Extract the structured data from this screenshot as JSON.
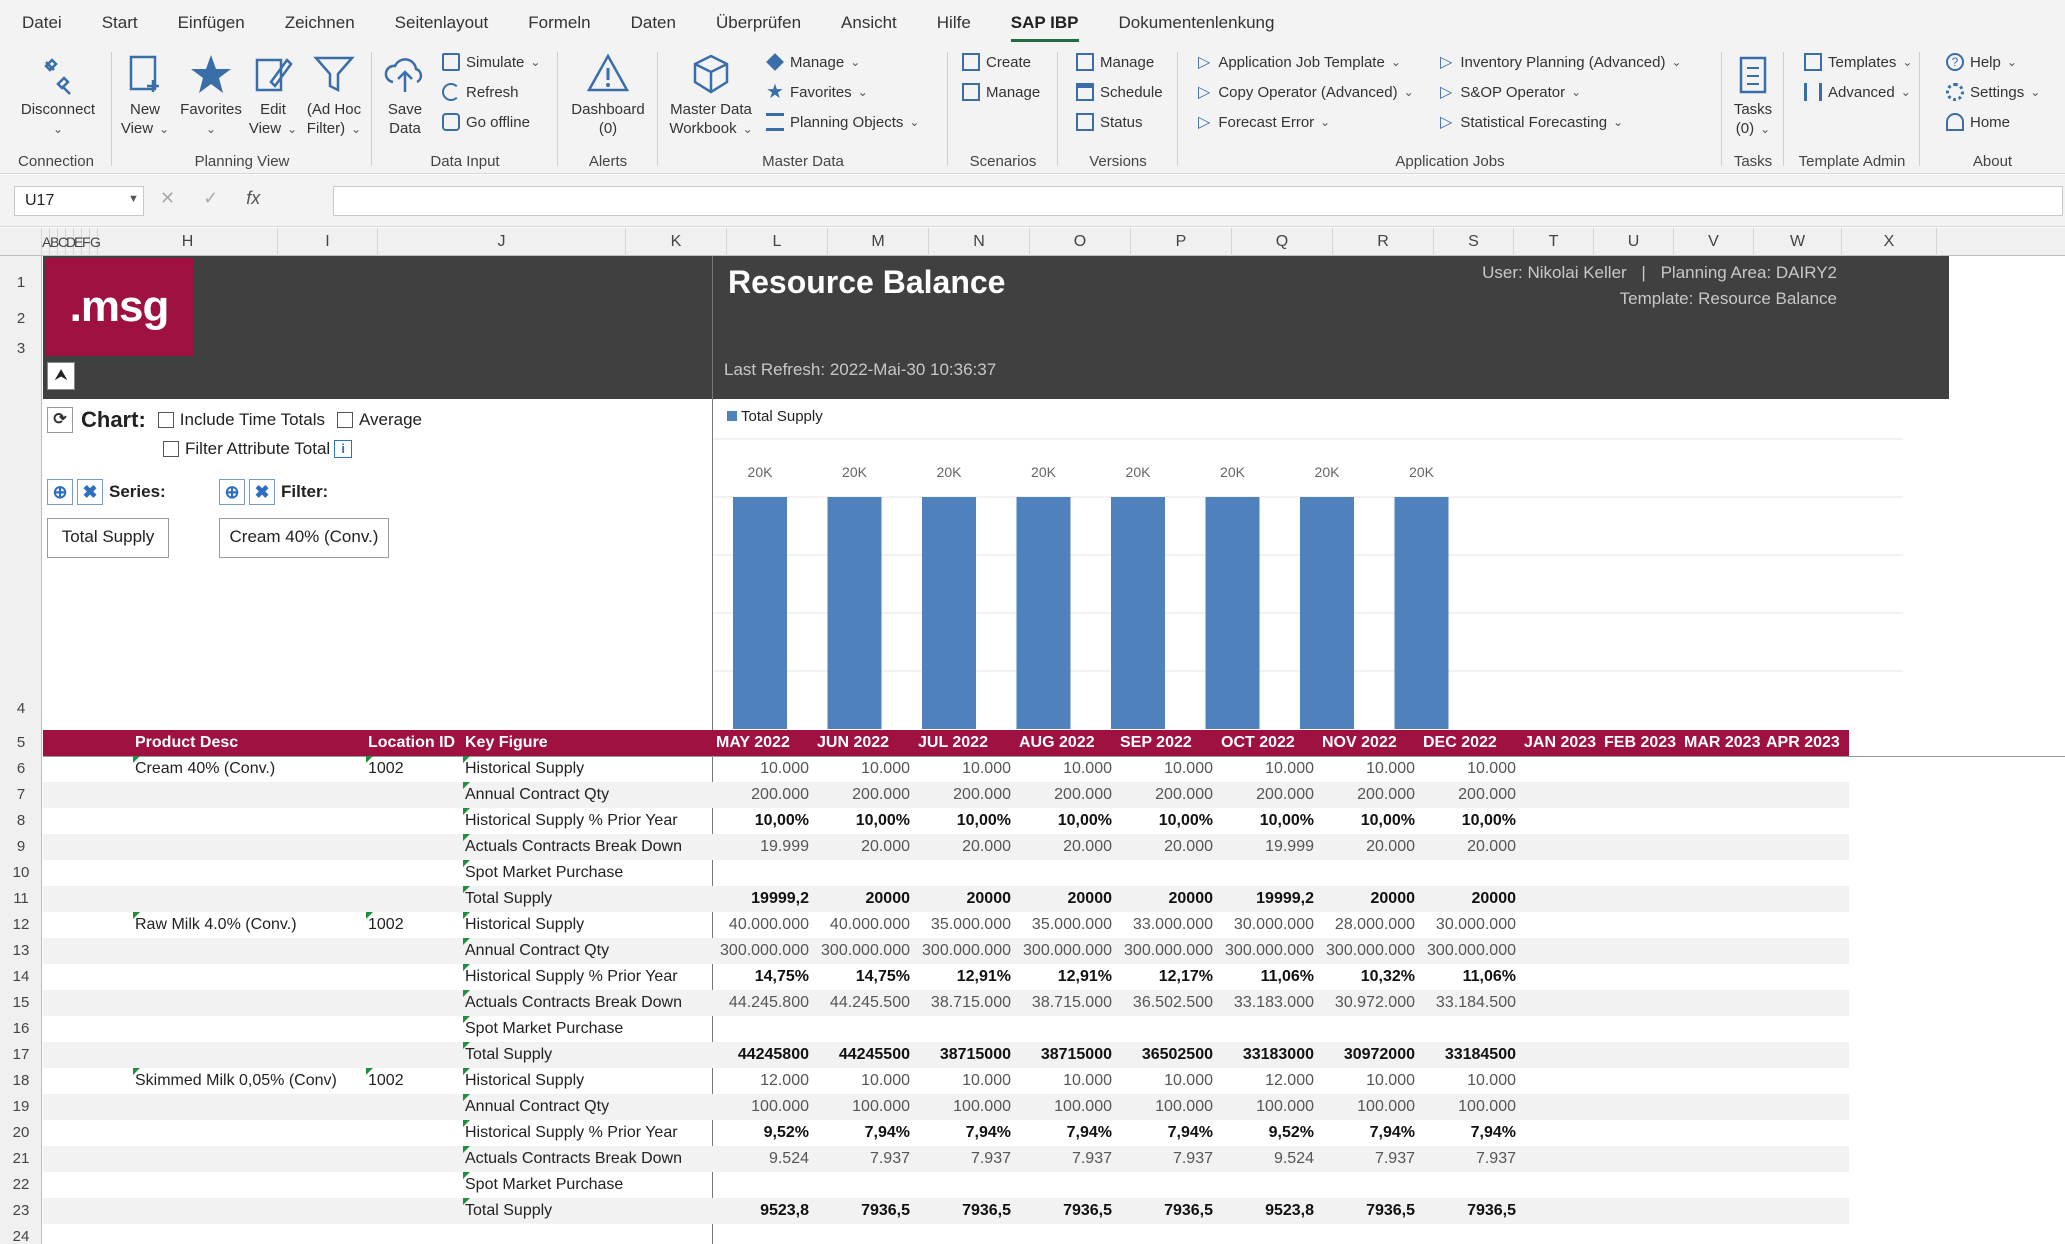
{
  "menu": [
    "Datei",
    "Start",
    "Einfügen",
    "Zeichnen",
    "Seitenlayout",
    "Formeln",
    "Daten",
    "Überprüfen",
    "Ansicht",
    "Hilfe",
    "SAP IBP",
    "Dokumentenlenkung"
  ],
  "ribbon": {
    "connection": {
      "disconnect": "Disconnect",
      "group": "Connection"
    },
    "planning_view": {
      "new_view": "New",
      "new_view2": "View",
      "favorites": "Favorites",
      "edit_view": "Edit",
      "edit_view2": "View",
      "adhoc": "(Ad Hoc",
      "adhoc2": "Filter)",
      "group": "Planning View"
    },
    "data_input": {
      "save": "Save",
      "save2": "Data",
      "simulate": "Simulate",
      "refresh": "Refresh",
      "go_offline": "Go offline",
      "group": "Data Input"
    },
    "alerts": {
      "dashboard": "Dashboard",
      "count": "(0)",
      "group": "Alerts"
    },
    "master_data": {
      "workbook": "Master Data",
      "workbook2": "Workbook",
      "manage": "Manage",
      "favorites": "Favorites",
      "planning_objects": "Planning Objects",
      "group": "Master Data"
    },
    "scenarios": {
      "create": "Create",
      "manage": "Manage",
      "group": "Scenarios"
    },
    "versions": {
      "manage": "Manage",
      "schedule": "Schedule",
      "status": "Status",
      "group": "Versions"
    },
    "app_jobs": {
      "template": "Application Job Template",
      "copy_op": "Copy Operator (Advanced)",
      "forecast_error": "Forecast Error",
      "inv_planning": "Inventory Planning (Advanced)",
      "sop": "S&OP Operator",
      "stat_forecast": "Statistical Forecasting",
      "group": "Application Jobs"
    },
    "tasks": {
      "tasks": "Tasks",
      "count": "(0)",
      "group": "Tasks"
    },
    "template_admin": {
      "templates": "Templates",
      "advanced": "Advanced",
      "group": "Template Admin"
    },
    "about": {
      "help": "Help",
      "settings": "Settings",
      "home": "Home",
      "group": "About"
    }
  },
  "formula": {
    "namebox": "U17",
    "fx": "fx",
    "value": ""
  },
  "columns": [
    "A",
    "B",
    "C",
    "D",
    "E",
    "F",
    "G",
    "H",
    "I",
    "J",
    "K",
    "L",
    "M",
    "N",
    "O",
    "P",
    "Q",
    "R",
    "S",
    "T",
    "U",
    "V",
    "W",
    "X"
  ],
  "rows": [
    "1",
    "2",
    "3",
    "4",
    "5",
    "6",
    "7",
    "8",
    "9",
    "10",
    "11",
    "12",
    "13",
    "14",
    "15",
    "16",
    "17",
    "18",
    "19",
    "20",
    "21",
    "22",
    "23",
    "24"
  ],
  "banner": {
    "logo": ".msg",
    "title": "Resource Balance",
    "user": "User: Nikolai Keller",
    "area": "Planning Area: DAIRY2",
    "template": "Template: Resource Balance",
    "last_refresh": "Last Refresh: 2022-Mai-30  10:36:37"
  },
  "chart_controls": {
    "chart_label": "Chart:",
    "include_time_totals": "Include Time Totals",
    "average": "Average",
    "filter_attr_total": "Filter Attribute Total",
    "series_label": "Series:",
    "filter_label": "Filter:",
    "series_value": "Total Supply",
    "filter_value": "Cream 40% (Conv.)"
  },
  "chart_data": {
    "type": "bar",
    "categories": [
      "MAY 2022",
      "JUN 2022",
      "JUL 2022",
      "AUG 2022",
      "SEP 2022",
      "OCT 2022",
      "NOV 2022",
      "DEC 2022"
    ],
    "series": [
      {
        "name": "Total Supply",
        "values": [
          19999.2,
          20000,
          20000,
          20000,
          20000,
          19999.2,
          20000,
          20000
        ],
        "labels": [
          "20K",
          "20K",
          "20K",
          "20K",
          "20K",
          "20K",
          "20K",
          "20K"
        ],
        "color": "#4f81bd"
      }
    ],
    "ylim": [
      0,
      25000
    ],
    "legend": "top-left",
    "grid": true
  },
  "table": {
    "headers": {
      "product": "Product Desc",
      "location": "Location ID",
      "keyfigure": "Key Figure"
    },
    "months": [
      "MAY 2022",
      "JUN 2022",
      "JUL 2022",
      "AUG 2022",
      "SEP 2022",
      "OCT 2022",
      "NOV 2022",
      "DEC 2022",
      "JAN 2023",
      "FEB 2023",
      "MAR 2023",
      "APR 2023"
    ],
    "rows": [
      {
        "product": "Cream 40% (Conv.)",
        "location": "1002",
        "kf": "Historical Supply",
        "bold": false,
        "vals": [
          "10.000",
          "10.000",
          "10.000",
          "10.000",
          "10.000",
          "10.000",
          "10.000",
          "10.000"
        ]
      },
      {
        "product": "",
        "location": "",
        "kf": "Annual Contract Qty",
        "bold": false,
        "vals": [
          "200.000",
          "200.000",
          "200.000",
          "200.000",
          "200.000",
          "200.000",
          "200.000",
          "200.000"
        ]
      },
      {
        "product": "",
        "location": "",
        "kf": "Historical Supply % Prior Year",
        "bold": true,
        "vals": [
          "10,00%",
          "10,00%",
          "10,00%",
          "10,00%",
          "10,00%",
          "10,00%",
          "10,00%",
          "10,00%"
        ]
      },
      {
        "product": "",
        "location": "",
        "kf": "Actuals Contracts Break Down",
        "bold": false,
        "vals": [
          "19.999",
          "20.000",
          "20.000",
          "20.000",
          "20.000",
          "19.999",
          "20.000",
          "20.000"
        ]
      },
      {
        "product": "",
        "location": "",
        "kf": "Spot Market Purchase",
        "bold": false,
        "vals": [
          "",
          "",
          "",
          "",
          "",
          "",
          "",
          ""
        ]
      },
      {
        "product": "",
        "location": "",
        "kf": "Total Supply",
        "bold": true,
        "vals": [
          "19999,2",
          "20000",
          "20000",
          "20000",
          "20000",
          "19999,2",
          "20000",
          "20000"
        ]
      },
      {
        "product": "Raw Milk 4.0% (Conv.)",
        "location": "1002",
        "kf": "Historical Supply",
        "bold": false,
        "vals": [
          "40.000.000",
          "40.000.000",
          "35.000.000",
          "35.000.000",
          "33.000.000",
          "30.000.000",
          "28.000.000",
          "30.000.000"
        ]
      },
      {
        "product": "",
        "location": "",
        "kf": "Annual Contract Qty",
        "bold": false,
        "vals": [
          "300.000.000",
          "300.000.000",
          "300.000.000",
          "300.000.000",
          "300.000.000",
          "300.000.000",
          "300.000.000",
          "300.000.000"
        ]
      },
      {
        "product": "",
        "location": "",
        "kf": "Historical Supply % Prior Year",
        "bold": true,
        "vals": [
          "14,75%",
          "14,75%",
          "12,91%",
          "12,91%",
          "12,17%",
          "11,06%",
          "10,32%",
          "11,06%"
        ]
      },
      {
        "product": "",
        "location": "",
        "kf": "Actuals Contracts Break Down",
        "bold": false,
        "vals": [
          "44.245.800",
          "44.245.500",
          "38.715.000",
          "38.715.000",
          "36.502.500",
          "33.183.000",
          "30.972.000",
          "33.184.500"
        ]
      },
      {
        "product": "",
        "location": "",
        "kf": "Spot Market Purchase",
        "bold": false,
        "vals": [
          "",
          "",
          "",
          "",
          "",
          "",
          "",
          ""
        ]
      },
      {
        "product": "",
        "location": "",
        "kf": "Total Supply",
        "bold": true,
        "vals": [
          "44245800",
          "44245500",
          "38715000",
          "38715000",
          "36502500",
          "33183000",
          "30972000",
          "33184500"
        ]
      },
      {
        "product": "Skimmed Milk 0,05% (Conv)",
        "location": "1002",
        "kf": "Historical Supply",
        "bold": false,
        "vals": [
          "12.000",
          "10.000",
          "10.000",
          "10.000",
          "10.000",
          "12.000",
          "10.000",
          "10.000"
        ]
      },
      {
        "product": "",
        "location": "",
        "kf": "Annual Contract Qty",
        "bold": false,
        "vals": [
          "100.000",
          "100.000",
          "100.000",
          "100.000",
          "100.000",
          "100.000",
          "100.000",
          "100.000"
        ]
      },
      {
        "product": "",
        "location": "",
        "kf": "Historical Supply % Prior Year",
        "bold": true,
        "vals": [
          "9,52%",
          "7,94%",
          "7,94%",
          "7,94%",
          "7,94%",
          "9,52%",
          "7,94%",
          "7,94%"
        ]
      },
      {
        "product": "",
        "location": "",
        "kf": "Actuals Contracts Break Down",
        "bold": false,
        "vals": [
          "9.524",
          "7.937",
          "7.937",
          "7.937",
          "7.937",
          "9.524",
          "7.937",
          "7.937"
        ]
      },
      {
        "product": "",
        "location": "",
        "kf": "Spot Market Purchase",
        "bold": false,
        "vals": [
          "",
          "",
          "",
          "",
          "",
          "",
          "",
          ""
        ]
      },
      {
        "product": "",
        "location": "",
        "kf": "Total Supply",
        "bold": true,
        "vals": [
          "9523,8",
          "7936,5",
          "7936,5",
          "7936,5",
          "7936,5",
          "9523,8",
          "7936,5",
          "7936,5"
        ]
      }
    ]
  }
}
